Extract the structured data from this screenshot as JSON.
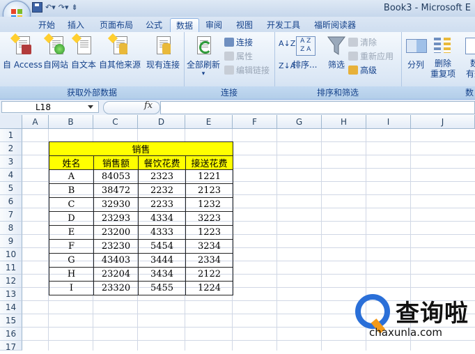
{
  "window": {
    "title": "Book3 - Microsoft E"
  },
  "tabs": [
    "开始",
    "插入",
    "页面布局",
    "公式",
    "数据",
    "审阅",
    "视图",
    "开发工具",
    "福昕阅读器"
  ],
  "active_tab": "数据",
  "ribbon": {
    "groups": {
      "external": {
        "label": "获取外部数据",
        "from_access": "自 Access",
        "from_web": "自网站",
        "from_text": "自文本",
        "from_other": "自其他来源",
        "existing": "现有连接"
      },
      "connections": {
        "label": "连接",
        "refresh_all": "全部刷新",
        "connections": "连接",
        "properties": "属性",
        "edit_links": "编辑链接"
      },
      "sort_filter": {
        "label": "排序和筛选",
        "sort": "排序...",
        "filter": "筛选",
        "clear": "清除",
        "reapply": "重新应用",
        "advanced": "高级"
      },
      "tools": {
        "label": "数",
        "text_to_columns": "分列",
        "remove_dup_1": "删除",
        "remove_dup_2": "重复项",
        "validation_1": "数",
        "validation_2": "有效"
      }
    }
  },
  "formula_bar": {
    "name_box": "L18",
    "fx_label": "fx",
    "formula": ""
  },
  "columns": [
    "A",
    "B",
    "C",
    "D",
    "E",
    "F",
    "G",
    "H",
    "I",
    "J"
  ],
  "rows": [
    "1",
    "2",
    "3",
    "4",
    "5",
    "6",
    "7",
    "8",
    "9",
    "10",
    "11",
    "12",
    "13",
    "14",
    "15",
    "16",
    "17"
  ],
  "table": {
    "title": "销售",
    "headers": [
      "姓名",
      "销售额",
      "餐饮花费",
      "接送花费"
    ],
    "highlight_color": "#ffff00",
    "rows": [
      [
        "A",
        "84053",
        "2323",
        "1221"
      ],
      [
        "B",
        "38472",
        "2232",
        "2123"
      ],
      [
        "C",
        "32930",
        "2233",
        "1232"
      ],
      [
        "D",
        "23293",
        "4334",
        "3223"
      ],
      [
        "E",
        "23200",
        "4333",
        "1223"
      ],
      [
        "F",
        "23230",
        "5454",
        "3234"
      ],
      [
        "G",
        "43403",
        "3444",
        "2334"
      ],
      [
        "H",
        "23204",
        "3434",
        "2122"
      ],
      [
        "I",
        "23320",
        "5455",
        "1224"
      ]
    ]
  },
  "watermark": {
    "text": "查询啦",
    "domain": "chaxunla.com"
  }
}
